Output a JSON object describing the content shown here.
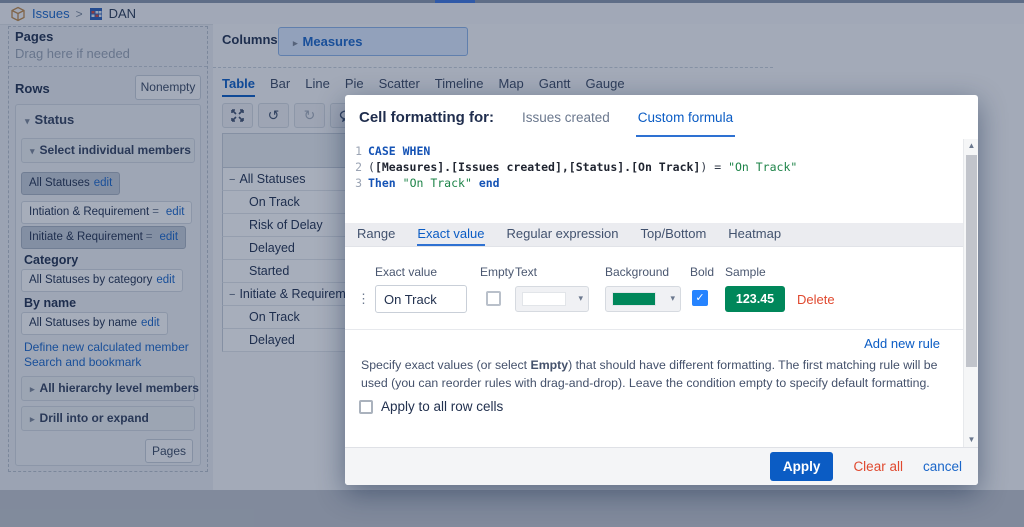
{
  "icons": {
    "chevron_down": "▾",
    "chevron_right": "▸",
    "collapse_minus": "−",
    "undo": "↺",
    "redo": "↻",
    "drag_handle": "⋮",
    "check": "✓",
    "scroll_up": "▲",
    "scroll_down": "▼",
    "breadcrumb_sep": ">"
  },
  "topbar": {
    "breadcrumb_root": "Issues",
    "report_name": "DAN"
  },
  "sidebar": {
    "pages_label": "Pages",
    "pages_placeholder": "Drag here if needed",
    "rows_label": "Rows",
    "nonempty_button": "Nonempty",
    "status": {
      "title": "Status",
      "select_members_label": "Select individual members",
      "members": [
        {
          "label": "All Statuses",
          "eq": "",
          "edit": "edit"
        },
        {
          "label": "Intiation & Requirement",
          "eq": "=",
          "edit": "edit"
        },
        {
          "label": "Initiate & Requirement",
          "eq": "=",
          "edit": "edit"
        }
      ],
      "category_heading": "Category",
      "category_item": {
        "label": "All Statuses by category",
        "edit": "edit"
      },
      "byname_heading": "By name",
      "byname_item": {
        "label": "All Statuses by name",
        "edit": "edit"
      },
      "links": [
        "Define new calculated member",
        "Search and bookmark"
      ],
      "hierarchy_panel": "All hierarchy level members",
      "drill_panel": "Drill into or expand",
      "pages_button": "Pages"
    }
  },
  "columns": {
    "label": "Columns",
    "measures_button": "Measures"
  },
  "chart_tabs": [
    "Table",
    "Bar",
    "Line",
    "Pie",
    "Scatter",
    "Timeline",
    "Map",
    "Gantt",
    "Gauge"
  ],
  "table": {
    "rows": [
      {
        "label": "All Statuses"
      },
      {
        "label": "On Track"
      },
      {
        "label": "Risk of Delay"
      },
      {
        "label": "Delayed"
      },
      {
        "label": "Started"
      },
      {
        "label": "Initiate & Requirement"
      },
      {
        "label": "On Track"
      },
      {
        "label": "Delayed"
      }
    ]
  },
  "dialog": {
    "title": "Cell formatting for:",
    "tabs": {
      "measure": "Issues created",
      "custom": "Custom formula"
    },
    "code": {
      "line_numbers": [
        "1",
        "2",
        "3"
      ],
      "line1": "CASE WHEN",
      "line2_open": "(",
      "line2_members": "[Measures].[Issues created],[Status].[On Track]",
      "line2_close": ") = ",
      "line2_string": "\"On Track\"",
      "line3_then": "Then",
      "line3_string": "\"On Track\"",
      "line3_end": "end"
    },
    "rule_tabs": [
      "Range",
      "Exact value",
      "Regular expression",
      "Top/Bottom",
      "Heatmap"
    ],
    "columns": {
      "exact": "Exact value",
      "empty": "Empty",
      "text": "Text",
      "background": "Background",
      "bold": "Bold",
      "sample": "Sample"
    },
    "rule": {
      "exact_value": "On Track",
      "sample": "123.45",
      "delete": "Delete",
      "background_color": "#00875A"
    },
    "add_new_rule": "Add new rule",
    "description": {
      "pre": "Specify exact values (or select ",
      "bold": "Empty",
      "post": ") that should have different formatting. The first matching rule will be used (you can reorder rules with drag-and-drop). Leave the condition empty to specify default formatting."
    },
    "apply_all_label": "Apply to all row cells",
    "footer": {
      "apply": "Apply",
      "clear": "Clear all",
      "cancel": "cancel"
    }
  },
  "colors": {
    "accent_blue": "#0b5cc4",
    "success_green": "#00875A",
    "danger_red": "#e0492f"
  }
}
